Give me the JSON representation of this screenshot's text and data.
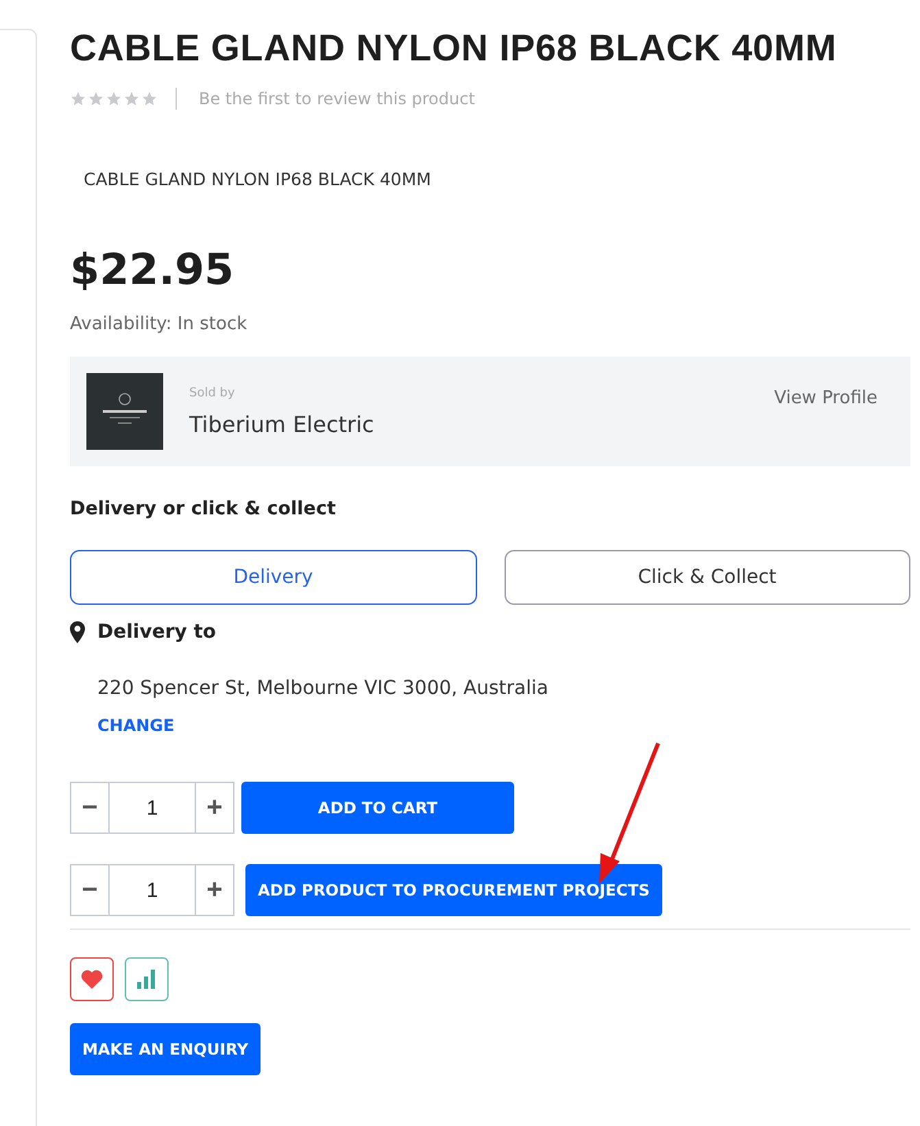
{
  "product": {
    "title": "CABLE GLAND NYLON IP68 BLACK 40MM",
    "stars": 0,
    "review_link": "Be the first to review this product",
    "description": "CABLE GLAND NYLON IP68 BLACK 40MM",
    "price": "$22.95",
    "availability": "Availability: In stock"
  },
  "seller": {
    "label": "Sold by",
    "name": "Tiberium Electric",
    "link": "View Profile"
  },
  "delivery": {
    "heading": "Delivery or click & collect",
    "options": [
      {
        "label": "Delivery",
        "selected": true
      },
      {
        "label": "Click & Collect",
        "selected": false
      }
    ],
    "to_label": "Delivery to",
    "address": "220 Spencer St, Melbourne VIC 3000, Australia",
    "change": "CHANGE"
  },
  "purchase_rows": [
    {
      "minus": "−",
      "quantity": "1",
      "plus": "+",
      "button": "ADD TO CART"
    },
    {
      "minus": "−",
      "quantity": "1",
      "plus": "+",
      "button": "ADD PRODUCT TO PROCUREMENT PROJECTS"
    }
  ],
  "enquiry": "MAKE AN ENQUIRY"
}
